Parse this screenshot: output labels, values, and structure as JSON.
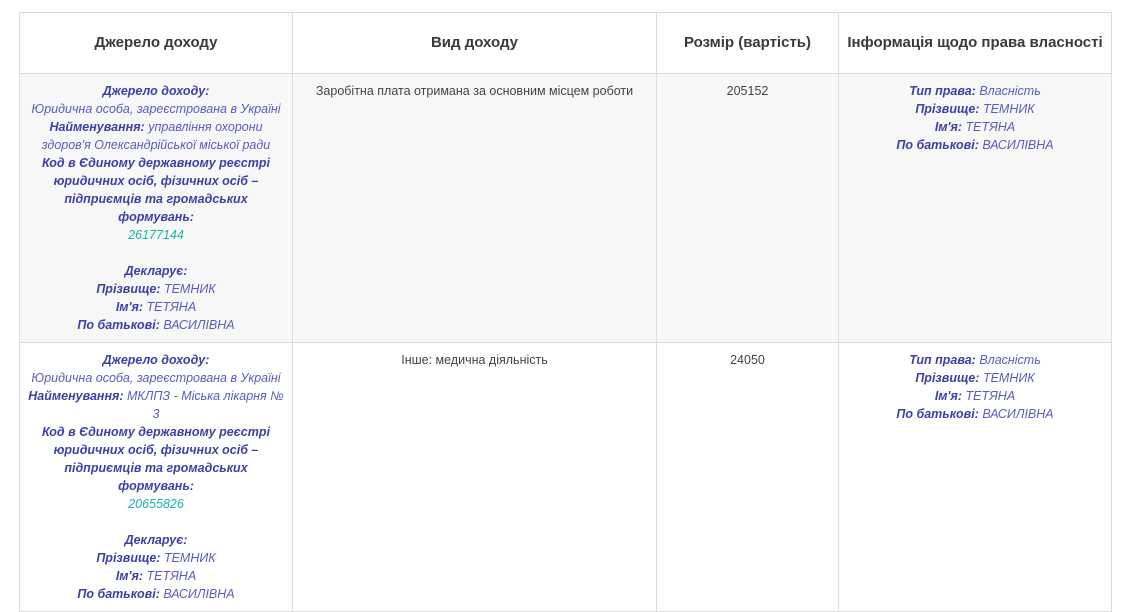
{
  "headers": {
    "source": "Джерело доходу",
    "type": "Вид доходу",
    "amount": "Розмір (вартість)",
    "ownership": "Інформація щодо права власності"
  },
  "labels": {
    "source": "Джерело доходу:",
    "name": "Найменування:",
    "code": "Код в Єдиному державному реєстрі юридичних осіб, фізичних осіб – підприємців та громадських формувань:",
    "declarant": "Декларує:",
    "surname": "Прізвище:",
    "firstname": "Ім'я:",
    "patronymic": "По батькові:",
    "right_type": "Тип права:"
  },
  "rows": [
    {
      "source_kind": "Юридична особа, зареєстрована в Україні",
      "org_name": "управління охорони здоров'я Олександрійської міської ради",
      "code": "26177144",
      "declarant": {
        "surname": "ТЕМНИК",
        "firstname": "ТЕТЯНА",
        "patronymic": "ВАСИЛІВНА"
      },
      "income_type": "Заробітна плата отримана за основним місцем роботи",
      "amount": "205152",
      "ownership": {
        "right_type": "Власність",
        "surname": "ТЕМНИК",
        "firstname": "ТЕТЯНА",
        "patronymic": "ВАСИЛІВНА"
      }
    },
    {
      "source_kind": "Юридична особа, зареєстрована в Україні",
      "org_name": "МКЛПЗ - Міська лікарня № 3",
      "code": "20655826",
      "declarant": {
        "surname": "ТЕМНИК",
        "firstname": "ТЕТЯНА",
        "patronymic": "ВАСИЛІВНА"
      },
      "income_type": "Інше: медична діяльність",
      "amount": "24050",
      "ownership": {
        "right_type": "Власність",
        "surname": "ТЕМНИК",
        "firstname": "ТЕТЯНА",
        "patronymic": "ВАСИЛІВНА"
      }
    }
  ]
}
